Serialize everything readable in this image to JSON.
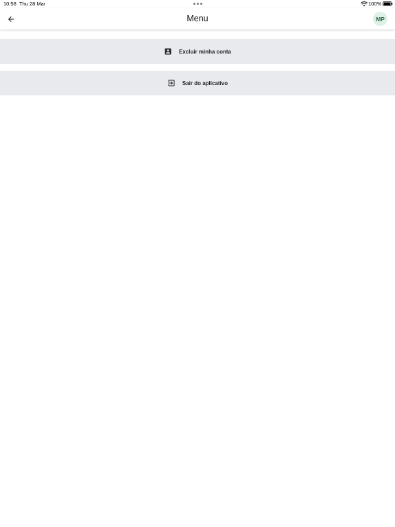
{
  "status_bar": {
    "time": "10:58",
    "date": "Thu 28 Mar",
    "battery": "100%"
  },
  "header": {
    "title": "Menu",
    "back_icon": "arrow-left-icon",
    "avatar_initials": "MP"
  },
  "menu": {
    "items": [
      {
        "label": "Excluir minha conta",
        "icon": "account-box-icon"
      },
      {
        "label": "Sair do aplicativo",
        "icon": "exit-to-app-icon"
      }
    ]
  },
  "colors": {
    "menu_item_bg": "#e8eaee",
    "avatar_bg": "#dff0e6",
    "avatar_text": "#2f6a44"
  }
}
